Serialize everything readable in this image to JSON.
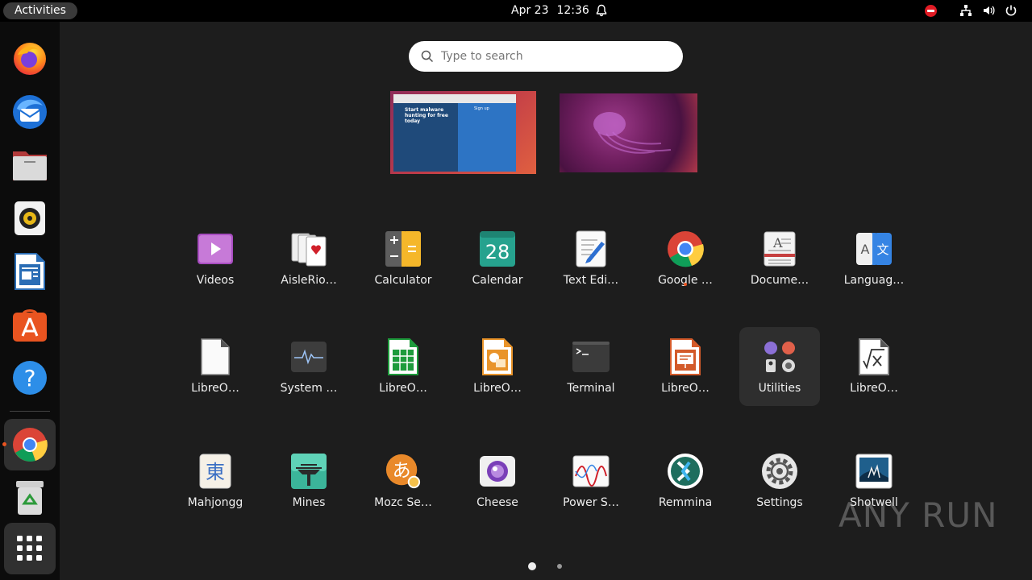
{
  "topbar": {
    "activities_label": "Activities",
    "date": "Apr 23",
    "time": "12:36",
    "icons": [
      "bell-icon",
      "do-not-disturb-icon",
      "network-icon",
      "volume-icon",
      "power-icon"
    ]
  },
  "dock": {
    "items": [
      {
        "name": "firefox",
        "icon": "firefox-icon"
      },
      {
        "name": "thunderbird",
        "icon": "thunderbird-icon"
      },
      {
        "name": "files",
        "icon": "files-icon"
      },
      {
        "name": "rhythmbox",
        "icon": "rhythmbox-icon"
      },
      {
        "name": "libreoffice-writer",
        "icon": "writer-icon"
      },
      {
        "name": "ubuntu-software",
        "icon": "software-center-icon"
      },
      {
        "name": "help",
        "icon": "help-icon"
      },
      {
        "name": "google-chrome",
        "icon": "chrome-icon",
        "running": true
      },
      {
        "name": "trash",
        "icon": "trash-icon"
      },
      {
        "name": "show-apps",
        "icon": "app-grid-icon"
      }
    ]
  },
  "search": {
    "placeholder": "Type to search"
  },
  "workspaces": [
    {
      "thumb_title": "Start malware hunting for free today",
      "thumb_signup": "Sign up"
    },
    {}
  ],
  "apps": {
    "row1": [
      {
        "label": "Videos",
        "icon": "videos-icon"
      },
      {
        "label": "AisleRio…",
        "icon": "aisleriot-icon"
      },
      {
        "label": "Calculator",
        "icon": "calculator-icon"
      },
      {
        "label": "Calendar",
        "icon": "calendar-icon",
        "day": "28"
      },
      {
        "label": "Text Edi…",
        "icon": "text-editor-icon"
      },
      {
        "label": "Google …",
        "icon": "chrome-icon",
        "running": true
      },
      {
        "label": "Docume…",
        "icon": "document-viewer-icon"
      },
      {
        "label": "Languag…",
        "icon": "language-icon"
      }
    ],
    "row2": [
      {
        "label": "LibreO…",
        "icon": "libreoffice-icon"
      },
      {
        "label": "System …",
        "icon": "system-monitor-icon"
      },
      {
        "label": "LibreO…",
        "icon": "libreoffice-calc-icon"
      },
      {
        "label": "LibreO…",
        "icon": "libreoffice-draw-icon"
      },
      {
        "label": "Terminal",
        "icon": "terminal-icon"
      },
      {
        "label": "LibreO…",
        "icon": "libreoffice-impress-icon"
      },
      {
        "label": "Utilities",
        "icon": "utilities-folder-icon"
      },
      {
        "label": "LibreO…",
        "icon": "libreoffice-math-icon"
      }
    ],
    "row3": [
      {
        "label": "Mahjongg",
        "icon": "mahjongg-icon",
        "glyph": "東"
      },
      {
        "label": "Mines",
        "icon": "mines-icon"
      },
      {
        "label": "Mozc Se…",
        "icon": "mozc-icon",
        "glyph": "あ"
      },
      {
        "label": "Cheese",
        "icon": "cheese-icon"
      },
      {
        "label": "Power S…",
        "icon": "power-statistics-icon"
      },
      {
        "label": "Remmina",
        "icon": "remmina-icon"
      },
      {
        "label": "Settings",
        "icon": "settings-icon"
      },
      {
        "label": "Shotwell",
        "icon": "shotwell-icon"
      }
    ]
  },
  "pager": {
    "pages": 2,
    "current": 1
  },
  "watermark": "ANY RUN"
}
